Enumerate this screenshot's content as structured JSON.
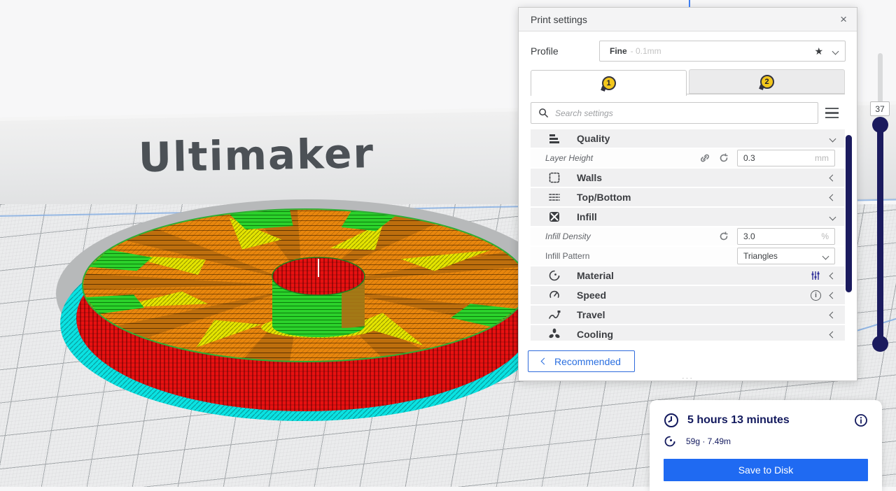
{
  "colors": {
    "accent": "#1f6af2",
    "navy": "#1b1b5e",
    "extruder_yellow": "#f3c71c"
  },
  "viewport": {
    "logo": "Ultimaker"
  },
  "panel": {
    "title": "Print settings",
    "close_glyph": "×",
    "resize_dots": "···",
    "profile": {
      "label": "Profile",
      "value": "Fine",
      "suffix": "- 0.1mm",
      "star_glyph": "★"
    },
    "tabs": [
      {
        "number": "1"
      },
      {
        "number": "2"
      }
    ],
    "search": {
      "placeholder": "Search settings"
    },
    "categories": [
      {
        "label": "Quality"
      },
      {
        "label": "Walls"
      },
      {
        "label": "Top/Bottom"
      },
      {
        "label": "Infill"
      },
      {
        "label": "Material"
      },
      {
        "label": "Speed"
      },
      {
        "label": "Travel"
      },
      {
        "label": "Cooling"
      }
    ],
    "settings": {
      "layer_height": {
        "label": "Layer Height",
        "value": "0.3",
        "unit": "mm"
      },
      "infill_density": {
        "label": "Infill Density",
        "value": "3.0",
        "unit": "%"
      },
      "infill_pattern": {
        "label": "Infill Pattern",
        "value": "Triangles"
      }
    },
    "speed_info_glyph": "i",
    "recommended_label": "Recommended"
  },
  "layer_slider": {
    "value": "37"
  },
  "output": {
    "time": "5 hours 13 minutes",
    "material": "59g · 7.49m",
    "save_button": "Save to Disk",
    "info_glyph": "i"
  }
}
